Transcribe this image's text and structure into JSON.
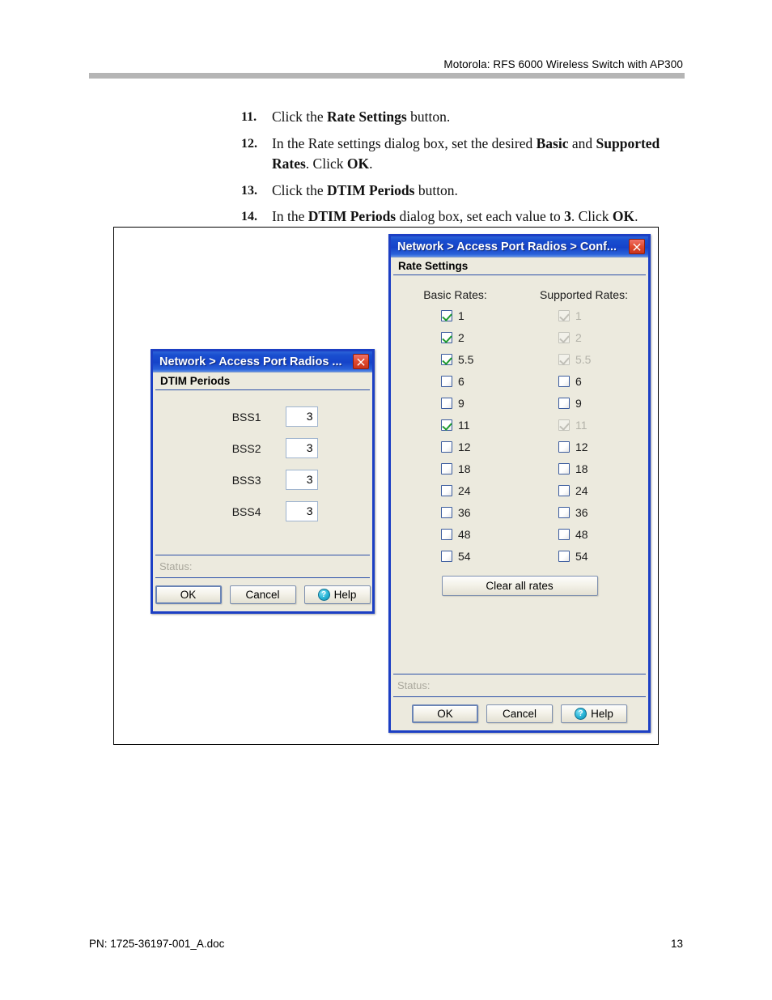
{
  "page": {
    "header_text": "Motorola: RFS 6000 Wireless Switch with AP300",
    "footer_doc": "PN: 1725-36197-001_A.doc",
    "footer_page": "13"
  },
  "steps": [
    {
      "num": "11.",
      "html": "Click the <b>Rate Settings</b> button."
    },
    {
      "num": "12.",
      "html": "In the Rate settings dialog box, set the desired <b>Basic</b> and <b>Supported Rates</b>. Click <b>OK</b>."
    },
    {
      "num": "13.",
      "html": "Click the <b>DTIM Periods</b> button."
    },
    {
      "num": "14.",
      "html": "In the <b>DTIM Periods</b> dialog box, set each value to <b>3</b>. Click <b>OK</b>."
    }
  ],
  "dtim_dialog": {
    "titlebar": "Network > Access Port Radios ...",
    "panel_title": "DTIM Periods",
    "rows": [
      {
        "label": "BSS1",
        "value": "3"
      },
      {
        "label": "BSS2",
        "value": "3"
      },
      {
        "label": "BSS3",
        "value": "3"
      },
      {
        "label": "BSS4",
        "value": "3"
      }
    ],
    "status_label": "Status:",
    "buttons": {
      "ok": "OK",
      "cancel": "Cancel",
      "help": "Help",
      "help_glyph": "?"
    },
    "close_icon": "close-icon"
  },
  "rate_dialog": {
    "titlebar": "Network > Access Port Radios > Conf...",
    "panel_title": "Rate Settings",
    "columns": {
      "basic": "Basic Rates:",
      "supported": "Supported Rates:"
    },
    "rates": [
      {
        "label": "1",
        "basic_checked": true,
        "basic_disabled": false,
        "supported_checked": true,
        "supported_disabled": true
      },
      {
        "label": "2",
        "basic_checked": true,
        "basic_disabled": false,
        "supported_checked": true,
        "supported_disabled": true
      },
      {
        "label": "5.5",
        "basic_checked": true,
        "basic_disabled": false,
        "supported_checked": true,
        "supported_disabled": true
      },
      {
        "label": "6",
        "basic_checked": false,
        "basic_disabled": false,
        "supported_checked": false,
        "supported_disabled": false
      },
      {
        "label": "9",
        "basic_checked": false,
        "basic_disabled": false,
        "supported_checked": false,
        "supported_disabled": false
      },
      {
        "label": "11",
        "basic_checked": true,
        "basic_disabled": false,
        "supported_checked": true,
        "supported_disabled": true
      },
      {
        "label": "12",
        "basic_checked": false,
        "basic_disabled": false,
        "supported_checked": false,
        "supported_disabled": false
      },
      {
        "label": "18",
        "basic_checked": false,
        "basic_disabled": false,
        "supported_checked": false,
        "supported_disabled": false
      },
      {
        "label": "24",
        "basic_checked": false,
        "basic_disabled": false,
        "supported_checked": false,
        "supported_disabled": false
      },
      {
        "label": "36",
        "basic_checked": false,
        "basic_disabled": false,
        "supported_checked": false,
        "supported_disabled": false
      },
      {
        "label": "48",
        "basic_checked": false,
        "basic_disabled": false,
        "supported_checked": false,
        "supported_disabled": false
      },
      {
        "label": "54",
        "basic_checked": false,
        "basic_disabled": false,
        "supported_checked": false,
        "supported_disabled": false
      }
    ],
    "clear_all_label": "Clear all rates",
    "status_label": "Status:",
    "buttons": {
      "ok": "OK",
      "cancel": "Cancel",
      "help": "Help",
      "help_glyph": "?"
    },
    "close_icon": "close-icon"
  },
  "colors": {
    "titlebar_blue": "#1543c9",
    "window_border": "#1c3fc4",
    "dialog_face": "#eceade",
    "check_green": "#1e9a2e",
    "close_red": "#e04a2e",
    "help_cyan": "#27b4d6",
    "header_rule_gray": "#b5b5b5"
  }
}
